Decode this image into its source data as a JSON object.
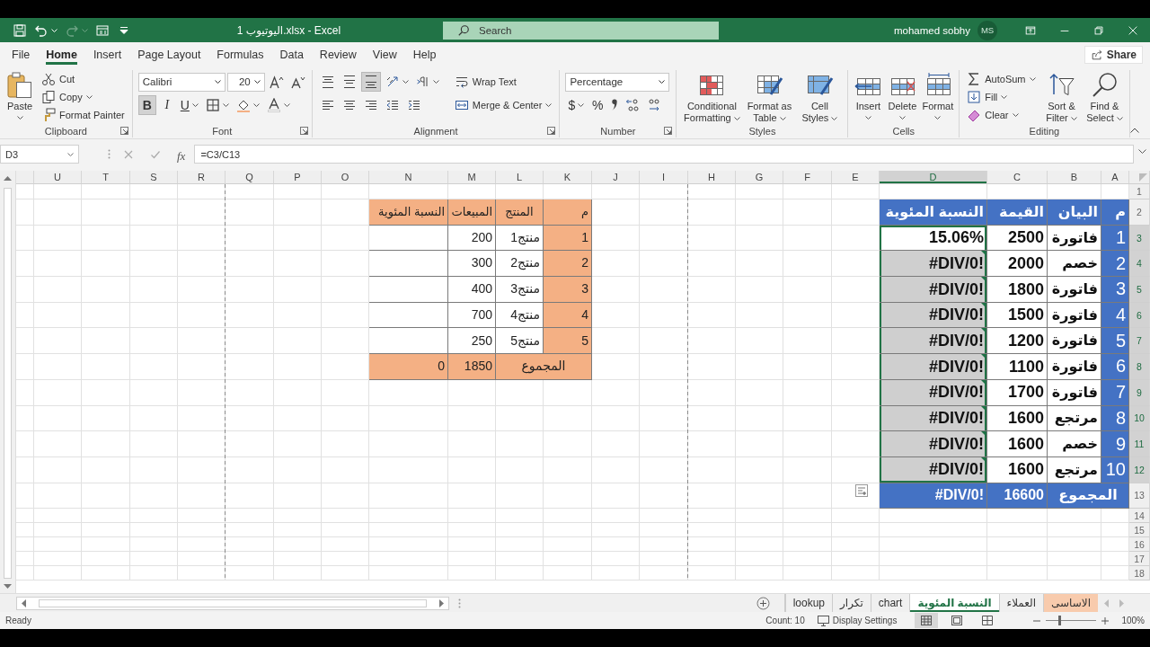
{
  "window": {
    "title": "اليوتيوب 1.xlsx - Excel"
  },
  "quick_access": [
    {
      "kind": "save",
      "disabled": false
    },
    {
      "kind": "undo",
      "disabled": false
    },
    {
      "kind": "redo",
      "disabled": true
    },
    {
      "kind": "form",
      "disabled": false
    },
    {
      "kind": "customize",
      "disabled": false
    }
  ],
  "search": {
    "placeholder": "Search"
  },
  "user": {
    "name": "mohamed sobhy",
    "initials": "MS"
  },
  "menu_tabs": [
    {
      "label": "File",
      "selected": false
    },
    {
      "label": "Home",
      "selected": true
    },
    {
      "label": "Insert",
      "selected": false
    },
    {
      "label": "Page Layout",
      "selected": false
    },
    {
      "label": "Formulas",
      "selected": false
    },
    {
      "label": "Data",
      "selected": false
    },
    {
      "label": "Review",
      "selected": false
    },
    {
      "label": "View",
      "selected": false
    },
    {
      "label": "Help",
      "selected": false
    }
  ],
  "share": "Share",
  "ribbon": {
    "groups": [
      {
        "label": "Clipboard",
        "launcher": true,
        "stacks": [
          {
            "lines": [
              [
                {
                  "kind": "split",
                  "label": "Paste",
                  "menu": true
                }
              ]
            ]
          },
          {
            "lines": [
              [
                {
                  "kind": "small",
                  "label": "Cut"
                }
              ],
              [
                {
                  "kind": "small",
                  "label": "Copy",
                  "menu": true
                }
              ],
              [
                {
                  "kind": "small",
                  "label": "Format Painter"
                }
              ]
            ]
          }
        ]
      },
      {
        "label": "Font",
        "launcher": true,
        "stacks": [
          {
            "lines": [
              [
                {
                  "kind": "field",
                  "value": "Calibri"
                },
                {
                  "kind": "field",
                  "value": "20"
                },
                {
                  "kind": "icon"
                },
                {
                  "kind": "icon"
                }
              ],
              [
                {
                  "kind": "toggle",
                  "label": "B",
                  "on": true
                },
                {
                  "kind": "toggle",
                  "label": "I",
                  "on": false
                },
                {
                  "kind": "toggle",
                  "label": "U",
                  "on": false,
                  "menu": true
                },
                {
                  "kind": "icon",
                  "menu": true
                },
                {
                  "kind": "icon",
                  "menu": true
                },
                {
                  "kind": "icon",
                  "menu": true
                }
              ]
            ]
          }
        ]
      },
      {
        "label": "Alignment",
        "launcher": true,
        "stacks": [
          {
            "lines": [
              [
                {
                  "kind": "icon",
                  "on": false
                },
                {
                  "kind": "icon",
                  "on": false
                },
                {
                  "kind": "icon",
                  "on": true
                },
                {
                  "kind": "icon",
                  "menu": true
                },
                {
                  "kind": "icon",
                  "menu": true
                }
              ],
              [
                {
                  "kind": "icon",
                  "on": false
                },
                {
                  "kind": "icon",
                  "on": false
                },
                {
                  "kind": "icon",
                  "on": false
                },
                {
                  "kind": "icon"
                },
                {
                  "kind": "icon"
                }
              ]
            ]
          },
          {
            "lines": [
              [
                {
                  "kind": "small",
                  "label": "Wrap Text"
                }
              ],
              [
                {
                  "kind": "small",
                  "label": "Merge & Center",
                  "menu": true
                }
              ]
            ]
          }
        ]
      },
      {
        "label": "Number",
        "launcher": true,
        "stacks": [
          {
            "lines": [
              [
                {
                  "kind": "field",
                  "value": "Percentage"
                }
              ],
              [
                {
                  "kind": "toggle",
                  "label": "$",
                  "menu": true
                },
                {
                  "kind": "toggle",
                  "label": "%"
                },
                {
                  "kind": "icon"
                },
                {
                  "kind": "icon"
                },
                {
                  "kind": "icon"
                }
              ]
            ]
          }
        ]
      },
      {
        "label": "Styles",
        "stacks": [
          {
            "lines": [
              [
                {
                  "kind": "large",
                  "label": "Conditional Formatting",
                  "menu": true
                }
              ]
            ]
          },
          {
            "lines": [
              [
                {
                  "kind": "large",
                  "label": "Format as Table",
                  "menu": true
                }
              ]
            ]
          },
          {
            "lines": [
              [
                {
                  "kind": "large",
                  "label": "Cell Styles",
                  "menu": true
                }
              ]
            ]
          }
        ]
      },
      {
        "label": "Cells",
        "stacks": [
          {
            "lines": [
              [
                {
                  "kind": "split",
                  "label": "Insert",
                  "menu": true
                }
              ]
            ]
          },
          {
            "lines": [
              [
                {
                  "kind": "split",
                  "label": "Delete",
                  "menu": true
                }
              ]
            ]
          },
          {
            "lines": [
              [
                {
                  "kind": "split",
                  "label": "Format",
                  "menu": true
                }
              ]
            ]
          }
        ]
      },
      {
        "label": "Editing",
        "stacks": [
          {
            "lines": [
              [
                {
                  "kind": "small",
                  "label": "AutoSum",
                  "menu": true
                }
              ],
              [
                {
                  "kind": "small",
                  "label": "Fill",
                  "menu": true
                }
              ],
              [
                {
                  "kind": "small",
                  "label": "Clear",
                  "menu": true
                }
              ]
            ]
          },
          {
            "lines": [
              [
                {
                  "kind": "large",
                  "label": "Sort & Filter",
                  "menu": true
                }
              ]
            ]
          },
          {
            "lines": [
              [
                {
                  "kind": "large",
                  "label": "Find & Select",
                  "menu": true
                }
              ]
            ]
          }
        ]
      }
    ]
  },
  "formula_bar": {
    "name_box": "D3",
    "function_label": "fx",
    "formula": "=C3/C13"
  },
  "sheet": {
    "columns": [
      {
        "label": "U",
        "selected": false
      },
      {
        "label": "T",
        "selected": false
      },
      {
        "label": "S",
        "selected": false
      },
      {
        "label": "R",
        "selected": false
      },
      {
        "label": "Q",
        "selected": false,
        "page_break": true
      },
      {
        "label": "P",
        "selected": false
      },
      {
        "label": "O",
        "selected": false
      },
      {
        "label": "N",
        "selected": false
      },
      {
        "label": "M",
        "selected": false
      },
      {
        "label": "L",
        "selected": false
      },
      {
        "label": "K",
        "selected": false
      },
      {
        "label": "J",
        "selected": false
      },
      {
        "label": "I",
        "selected": false
      },
      {
        "label": "H",
        "selected": false,
        "page_break": true
      },
      {
        "label": "G",
        "selected": false
      },
      {
        "label": "F",
        "selected": false
      },
      {
        "label": "E",
        "selected": false
      },
      {
        "label": "D",
        "selected": true
      },
      {
        "label": "C",
        "selected": false
      },
      {
        "label": "B",
        "selected": false
      },
      {
        "label": "A",
        "selected": false
      }
    ],
    "rows": [
      {
        "label": "1",
        "selected": false
      },
      {
        "label": "2",
        "selected": false
      },
      {
        "label": "3",
        "selected": true
      },
      {
        "label": "4",
        "selected": true
      },
      {
        "label": "5",
        "selected": true
      },
      {
        "label": "6",
        "selected": true
      },
      {
        "label": "7",
        "selected": true
      },
      {
        "label": "8",
        "selected": true
      },
      {
        "label": "9",
        "selected": true
      },
      {
        "label": "10",
        "selected": true
      },
      {
        "label": "11",
        "selected": true
      },
      {
        "label": "12",
        "selected": true
      },
      {
        "label": "13",
        "selected": false
      },
      {
        "label": "14",
        "selected": false
      },
      {
        "label": "15",
        "selected": false
      },
      {
        "label": "16",
        "selected": false
      },
      {
        "label": "17",
        "selected": false
      },
      {
        "label": "18",
        "selected": false
      }
    ],
    "table_1": {
      "header": [
        "م",
        "المنتج",
        "المبيعات",
        "النسبة المئوية"
      ],
      "rows": [
        {
          "num": "1",
          "product": "منتج1",
          "sales": "200"
        },
        {
          "num": "2",
          "product": "منتج2",
          "sales": "300"
        },
        {
          "num": "3",
          "product": "منتج3",
          "sales": "400"
        },
        {
          "num": "4",
          "product": "منتج4",
          "sales": "700"
        },
        {
          "num": "5",
          "product": "منتج5",
          "sales": "250"
        }
      ],
      "total": {
        "label": "المجموع",
        "sales": "1850",
        "percent": "0"
      }
    },
    "table_2": {
      "header": [
        "م",
        "البيان",
        "القيمة",
        "النسبة المئوية"
      ],
      "rows": [
        {
          "num": "1",
          "item": "فاتورة",
          "value": "2500",
          "percent": "15.06%",
          "selected": true,
          "active": true,
          "flagged": false
        },
        {
          "num": "2",
          "item": "خصم",
          "value": "2000",
          "percent": "#DIV/0!",
          "selected": true,
          "active": false,
          "flagged": true
        },
        {
          "num": "3",
          "item": "فاتورة",
          "value": "1800",
          "percent": "#DIV/0!",
          "selected": true,
          "active": false,
          "flagged": true
        },
        {
          "num": "4",
          "item": "فاتورة",
          "value": "1500",
          "percent": "#DIV/0!",
          "selected": true,
          "active": false,
          "flagged": true
        },
        {
          "num": "5",
          "item": "فاتورة",
          "value": "1200",
          "percent": "#DIV/0!",
          "selected": true,
          "active": false,
          "flagged": true
        },
        {
          "num": "6",
          "item": "فاتورة",
          "value": "1100",
          "percent": "#DIV/0!",
          "selected": true,
          "active": false,
          "flagged": true
        },
        {
          "num": "7",
          "item": "فاتورة",
          "value": "1700",
          "percent": "#DIV/0!",
          "selected": true,
          "active": false,
          "flagged": true
        },
        {
          "num": "8",
          "item": "مرتجع",
          "value": "1600",
          "percent": "#DIV/0!",
          "selected": true,
          "active": false,
          "flagged": true
        },
        {
          "num": "9",
          "item": "خصم",
          "value": "1600",
          "percent": "#DIV/0!",
          "selected": true,
          "active": false,
          "flagged": true
        },
        {
          "num": "10",
          "item": "مرتجع",
          "value": "1600",
          "percent": "#DIV/0!",
          "selected": true,
          "active": false,
          "flagged": true
        }
      ],
      "total": {
        "label": "المجموع",
        "value": "16600",
        "percent": "#DIV/0!"
      }
    }
  },
  "sheet_tabs": [
    {
      "label": "الاساسى",
      "selected": false,
      "color": "#f8cbad"
    },
    {
      "label": "العملاء",
      "selected": false
    },
    {
      "label": "النسبة المئوية",
      "selected": true
    },
    {
      "label": "chart",
      "selected": false
    },
    {
      "label": "تكرار",
      "selected": false
    },
    {
      "label": "lookup",
      "selected": false
    }
  ],
  "status_bar": {
    "mode": "Ready",
    "count": "Count: 10",
    "display_settings": "Display Settings",
    "views": [
      {
        "kind": "normal",
        "selected": true
      },
      {
        "kind": "page_layout",
        "selected": false
      },
      {
        "kind": "page_break",
        "selected": false
      }
    ],
    "zoom": {
      "level": 0.25,
      "reading": "100%"
    }
  }
}
